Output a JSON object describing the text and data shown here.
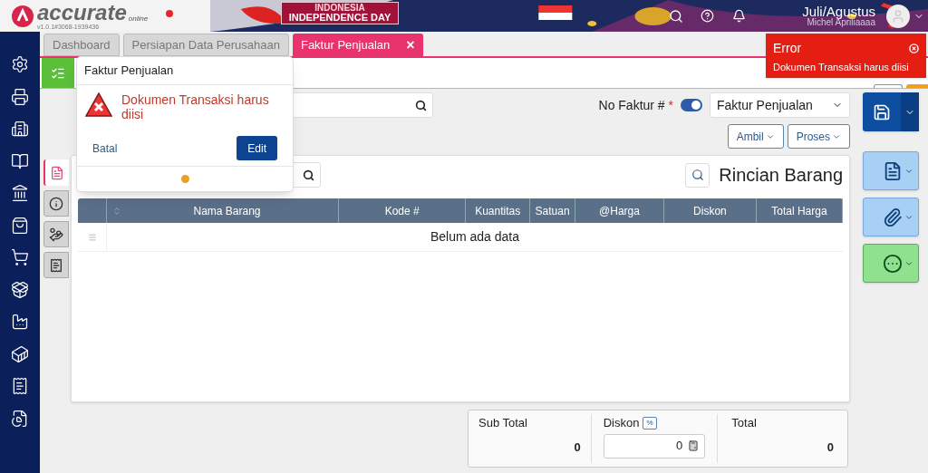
{
  "header": {
    "brand": "accurate",
    "brand_sub": "online",
    "version": "v1.0.1#3068-1939436",
    "banner_line1": "INDONESIA",
    "banner_line2": "INDEPENDENCE DAY",
    "period": "Juli/Agustus",
    "user": "Michel Apriliaaaa"
  },
  "tabs": [
    {
      "label": "Dashboard",
      "selected": false
    },
    {
      "label": "Persiapan Data Perusahaan",
      "selected": false
    },
    {
      "label": "Faktur Penjualan",
      "selected": true,
      "close": "×"
    }
  ],
  "form": {
    "no_faktur_label": "No Faktur #",
    "required_mark": "*",
    "auto_number": {
      "on": true
    },
    "type_select": "Faktur Penjualan",
    "buttons": [
      "Ambil",
      "Proses"
    ]
  },
  "side_tabs": [
    {
      "kind": "document",
      "selected": true
    },
    {
      "kind": "info",
      "selected": false
    },
    {
      "kind": "money",
      "selected": false
    },
    {
      "kind": "payment",
      "selected": false
    }
  ],
  "items": {
    "title": "Rincian Barang",
    "columns": [
      "Nama Barang",
      "Kode #",
      "Kuantitas",
      "Satuan",
      "@Harga",
      "Diskon",
      "Total Harga"
    ],
    "empty": "Belum ada data"
  },
  "totals": {
    "subtotal_label": "Sub Total",
    "subtotal": "0",
    "discount_label": "Diskon",
    "discount_unit": "%",
    "discount": "0",
    "total_label": "Total",
    "total": "0"
  },
  "popup": {
    "title": "Faktur Penjualan",
    "message": "Dokumen Transaksi harus diisi",
    "cancel": "Batal",
    "edit": "Edit"
  },
  "toast": {
    "title": "Error",
    "message": "Dokumen Transaksi harus diisi"
  }
}
